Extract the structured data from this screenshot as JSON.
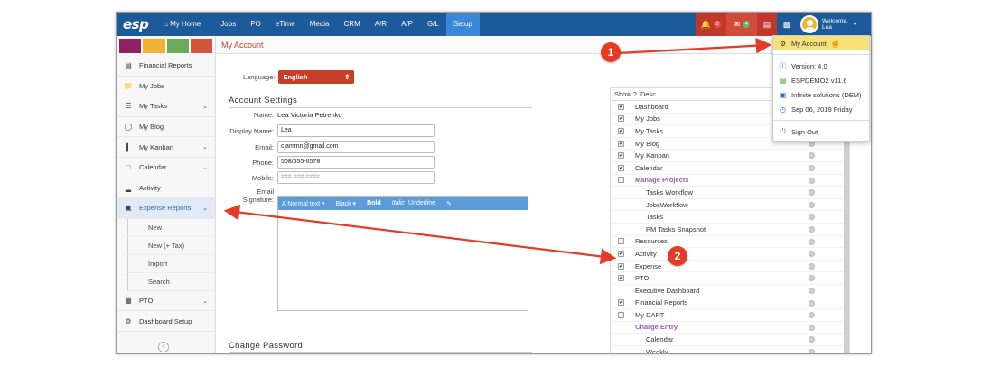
{
  "topnav": {
    "logo": "esp",
    "items": [
      "My Home",
      "Jobs",
      "PO",
      "eTime",
      "Media",
      "CRM",
      "A/R",
      "A/P",
      "G/L",
      "Setup"
    ],
    "badges": {
      "alerts": "8",
      "messages": "4"
    },
    "welcome_line1": "Welcome,",
    "welcome_line2": "Lea",
    "colors": {
      "bar": "#1c5a99",
      "active": "#3b88d6",
      "alert_box": "#c2372c",
      "mail_box": "#d24a3c"
    }
  },
  "sidebar": {
    "swatches": [
      "#8e1f62",
      "#f2b233",
      "#6aaa59",
      "#d1543b"
    ],
    "items": [
      {
        "label": "Financial Reports",
        "icon": "report-icon",
        "chevron": false
      },
      {
        "label": "My Jobs",
        "icon": "folder-icon",
        "chevron": false
      },
      {
        "label": "My Tasks",
        "icon": "tasks-icon",
        "chevron": true
      },
      {
        "label": "My Blog",
        "icon": "chat-icon",
        "chevron": false
      },
      {
        "label": "My Kanban",
        "icon": "kanban-icon",
        "chevron": true
      },
      {
        "label": "Calendar",
        "icon": "calendar-icon",
        "chevron": true
      },
      {
        "label": "Activity",
        "icon": "activity-icon",
        "chevron": false
      },
      {
        "label": "Expense Reports",
        "icon": "money-icon",
        "chevron": true,
        "active": true
      }
    ],
    "subitems": [
      "New",
      "New (+ Tax)",
      "Import",
      "Search"
    ],
    "bottom_items": [
      {
        "label": "PTO",
        "icon": "calendar-grid-icon",
        "chevron": true
      },
      {
        "label": "Dashboard Setup",
        "icon": "gears-icon",
        "chevron": false
      }
    ],
    "collapse_symbol": "«"
  },
  "main": {
    "page_title": "My Account",
    "language_label": "Language:",
    "language_value": "English",
    "account_settings_title": "Account Settings",
    "name_label": "Name:",
    "name_value": "Lea Victoria Petrenko",
    "display_name_label": "Display Name:",
    "display_name_value": "Lea",
    "email_label": "Email:",
    "email_value": "cjammn@gmail.com",
    "phone_label": "Phone:",
    "phone_value": "508/555-6578",
    "mobile_label": "Mobile:",
    "mobile_placeholder": "### ### ####",
    "signature_label_1": "Email",
    "signature_label_2": "Signature:",
    "editor_toolbar": [
      "A Normal text ▾",
      "Black ▾",
      "Bold",
      "Italic",
      "Underline",
      "✎"
    ],
    "change_password_title": "Change Password"
  },
  "rpanel": {
    "header_show": "Show",
    "header_q": "?",
    "header_desc": "Desc",
    "rows": [
      {
        "label": "Dashboard",
        "checked": true,
        "kind": "normal"
      },
      {
        "label": "My Jobs",
        "checked": true,
        "kind": "normal"
      },
      {
        "label": "My Tasks",
        "checked": true,
        "kind": "normal"
      },
      {
        "label": "My Blog",
        "checked": true,
        "kind": "normal"
      },
      {
        "label": "My Kanban",
        "checked": true,
        "kind": "normal"
      },
      {
        "label": "Calendar",
        "checked": true,
        "kind": "normal"
      },
      {
        "label": "Manage Projects",
        "checked": false,
        "kind": "group"
      },
      {
        "label": "Tasks Workflow",
        "checked": null,
        "kind": "sub"
      },
      {
        "label": "JobsWorkflow",
        "checked": null,
        "kind": "sub"
      },
      {
        "label": "Tasks",
        "checked": null,
        "kind": "sub"
      },
      {
        "label": "PM Tasks Snapshot",
        "checked": null,
        "kind": "sub"
      },
      {
        "label": "Resources",
        "checked": false,
        "kind": "normal"
      },
      {
        "label": "Activity",
        "checked": true,
        "kind": "normal"
      },
      {
        "label": "Expense",
        "checked": true,
        "kind": "normal"
      },
      {
        "label": "PTO",
        "checked": true,
        "kind": "normal"
      },
      {
        "label": "Executive Dashboard",
        "checked": null,
        "kind": "normal"
      },
      {
        "label": "Financial Reports",
        "checked": true,
        "kind": "normal"
      },
      {
        "label": "My DART",
        "checked": false,
        "kind": "normal"
      },
      {
        "label": "Charge Entry",
        "checked": null,
        "kind": "group"
      },
      {
        "label": "Calendar",
        "checked": null,
        "kind": "sub"
      },
      {
        "label": "Weekly",
        "checked": null,
        "kind": "sub"
      }
    ]
  },
  "dropdown": {
    "my_account": "My Account",
    "version": "Version: 4.0",
    "db": "ESPDEMO2 v11.6",
    "company": "Infinite solutions (DEM)",
    "date": "Sep 06, 2019 Friday",
    "sign_out": "Sign Out"
  },
  "annotations": {
    "badge1": "1",
    "badge2": "2",
    "color": "#e53b26"
  }
}
